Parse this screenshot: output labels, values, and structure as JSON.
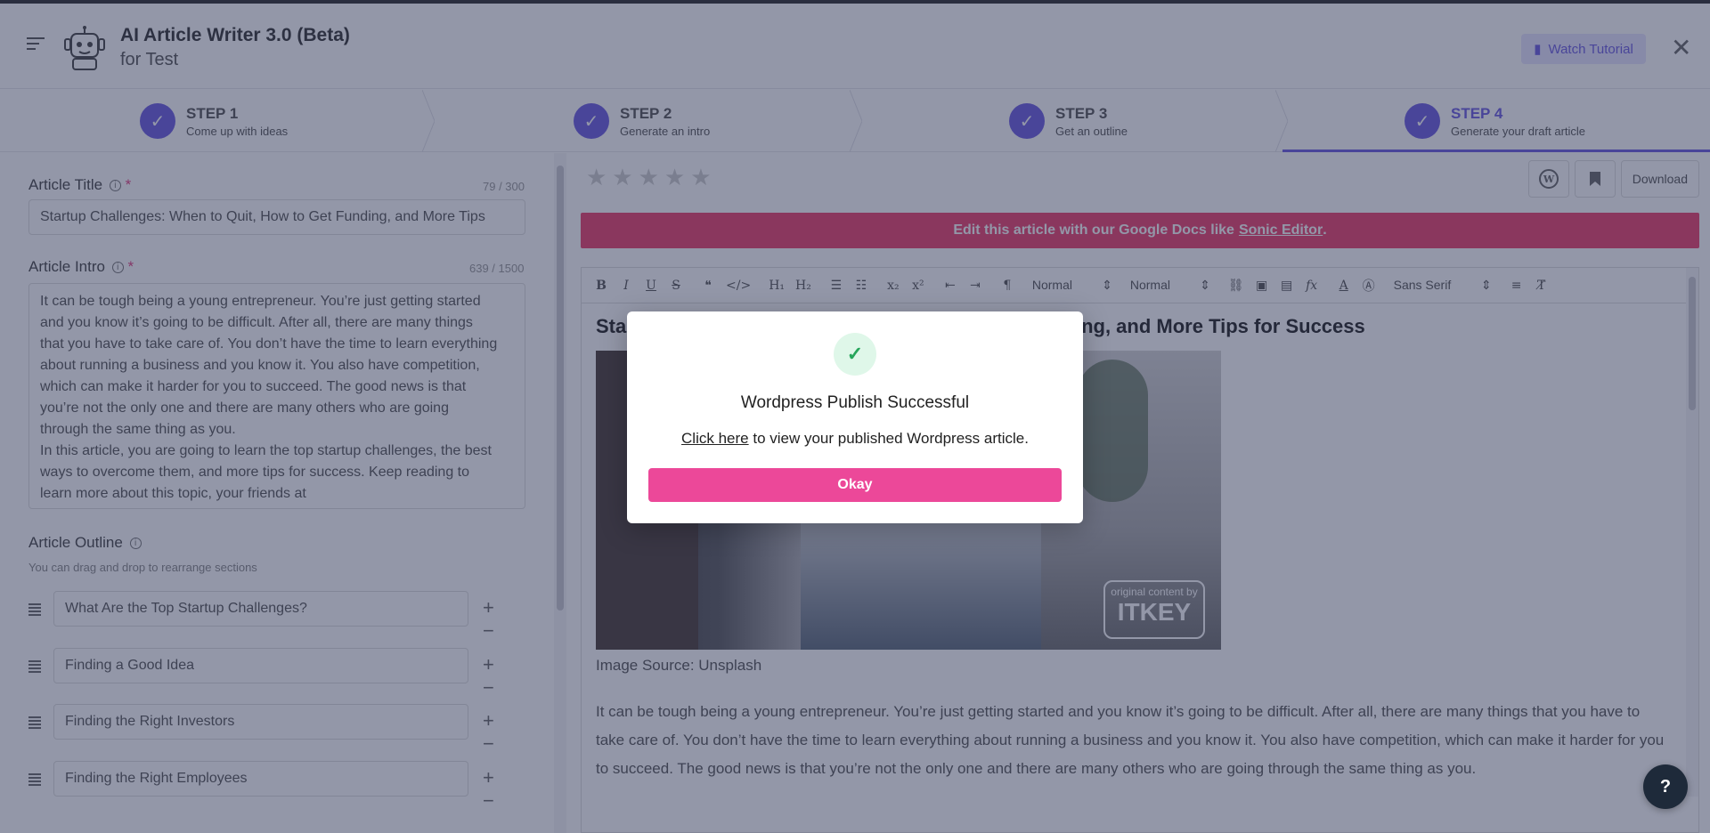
{
  "header": {
    "title": "AI Article Writer 3.0 (Beta)",
    "subtitle": "for Test",
    "watch_tutorial": "Watch Tutorial",
    "close": "✕"
  },
  "steps": [
    {
      "label": "STEP 1",
      "desc": "Come up with ideas"
    },
    {
      "label": "STEP 2",
      "desc": "Generate an intro"
    },
    {
      "label": "STEP 3",
      "desc": "Get an outline"
    },
    {
      "label": "STEP 4",
      "desc": "Generate your draft article"
    }
  ],
  "left": {
    "title_label": "Article Title",
    "title_counter": "79 / 300",
    "title_value": "Startup Challenges: When to Quit, How to Get Funding, and More Tips",
    "intro_label": "Article Intro",
    "intro_counter": "639 / 1500",
    "intro_value": "It can be tough being a young entrepreneur. You’re just getting started and you know it’s going to be difficult. After all, there are many things that you have to take care of. You don’t have the time to learn everything about running a business and you know it. You also have competition, which can make it harder for you to succeed. The good news is that you’re not the only one and there are many others who are going through the same thing as you.\nIn this article, you are going to learn the top startup challenges, the best ways to overcome them, and more tips for success. Keep reading to learn more about this topic, your friends at",
    "outline_label": "Article Outline",
    "outline_hint": "You can drag and drop to rearrange sections",
    "outline_items": [
      "What Are the Top Startup Challenges?",
      "Finding a Good Idea",
      "Finding the Right Investors",
      "Finding the Right Employees"
    ]
  },
  "right": {
    "download": "Download",
    "banner_text": "Edit this article with our Google Docs like",
    "banner_link": "Sonic Editor",
    "toolbar": {
      "header_select": "Normal",
      "size_select": "Normal",
      "font_select": "Sans Serif"
    },
    "article_title": "Startup Challenges: When to Quit, How to Get Funding, and More Tips for Success",
    "photo_badge_small": "original content by",
    "photo_badge_big": "ITKEY",
    "image_caption": "Image Source: Unsplash",
    "paragraph": "It can be tough being a young entrepreneur. You’re just getting started and you know it’s going to be difficult. After all, there are many things that you have to take care of. You don’t have the time to learn everything about running a business and you know it. You also have competition, which can make it harder for you to succeed. The good news is that you’re not the only one and there are many others who are going through the same thing as you."
  },
  "modal": {
    "title": "Wordpress Publish Successful",
    "link_text": "Click here",
    "body_rest": " to view your published Wordpress article.",
    "okay": "Okay"
  },
  "help": "?",
  "colors": {
    "accent": "#6a5ae0",
    "banner": "#ec3f6b",
    "okay_button": "#ec4899",
    "success": "#26a65b"
  },
  "icons": {
    "menu": "menu-icon",
    "logo": "robot-icon",
    "video": "video-camera-icon",
    "step_done": "check-icon",
    "wordpress": "wordpress-icon",
    "bookmark": "bookmark-icon",
    "drag": "drag-handle-icon",
    "help": "question-icon"
  }
}
